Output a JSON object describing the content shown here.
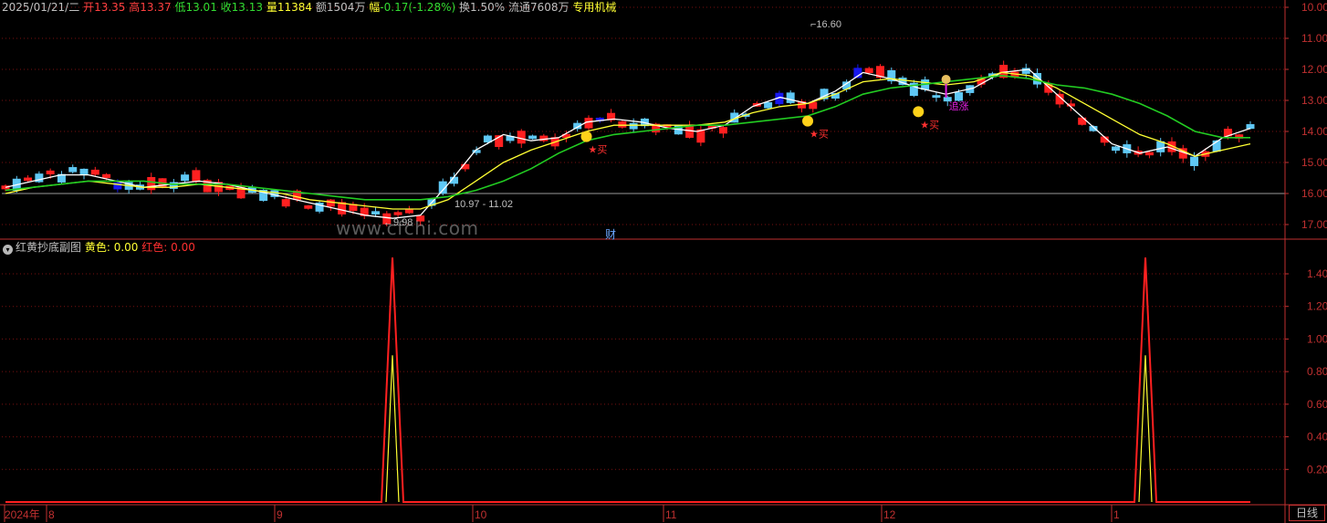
{
  "header": {
    "date": "2025/01/21/二",
    "open_label": "开",
    "open": "13.35",
    "high_label": "高",
    "high": "13.37",
    "low_label": "低",
    "low": "13.01",
    "close_label": "收",
    "close": "13.13",
    "vol_label": "量",
    "vol": "11384",
    "amount_label": "额",
    "amount": "1504万",
    "chg_label": "幅",
    "chg": "-0.17(-1.28%)",
    "turnover_label": "换",
    "turnover": "1.50%",
    "float_label": "流通",
    "float": "7608万",
    "sector": "专用机械"
  },
  "sub_panel": {
    "title": "红黄抄底副图",
    "yellow_label": "黄色:",
    "yellow_value": "0.00",
    "red_label": "红色:",
    "red_value": "0.00"
  },
  "annotations": {
    "high_price": "16.60",
    "low_price": "9.98",
    "range_text": "10.97 - 11.02",
    "buy": "★买",
    "surge": "追涨",
    "cai": "财",
    "watermark": "www.cfchi.com"
  },
  "axis": {
    "price_ticks": [
      "17.00",
      "16.00",
      "15.00",
      "14.00",
      "13.00",
      "12.00",
      "11.00",
      "10.00"
    ],
    "sub_ticks": [
      "1.40",
      "1.20",
      "1.00",
      "0.80",
      "0.60",
      "0.40",
      "0.20"
    ],
    "x_labels": [
      "2024年",
      "8",
      "9",
      "10",
      "11",
      "12",
      "1"
    ],
    "mode": "日线"
  },
  "colors": {
    "up": "#ff2020",
    "down_light": "#5fc8f5",
    "down_blue": "#1818f0",
    "ma_white": "#ffffff",
    "ma_yellow": "#ffff33",
    "ma_green": "#22cc22",
    "axis_red": "#c03030",
    "tick_text": "#c03030"
  },
  "chart_data": [
    {
      "type": "candlestick",
      "title": "",
      "ylim": [
        9.6,
        17.2
      ],
      "x_months": [
        "8",
        "9",
        "10",
        "11",
        "12",
        "1"
      ],
      "price_ticks": [
        10,
        11,
        12,
        13,
        14,
        15,
        16,
        17
      ],
      "marked_high": 16.6,
      "marked_low": 9.98,
      "close_ref_line": 11.0,
      "series": [
        {
          "name": "",
          "role": "ma_short_white",
          "values": [
            11.2,
            11.4,
            11.6,
            11.6,
            11.4,
            11.2,
            11.3,
            11.4,
            11.3,
            11.1,
            10.9,
            10.7,
            10.5,
            10.3,
            10.2,
            10.3,
            11.3,
            12.4,
            12.9,
            12.7,
            12.8,
            13.3,
            13.4,
            13.3,
            13.1,
            13.0,
            13.2,
            13.8,
            14.1,
            13.9,
            14.3,
            14.9,
            14.7,
            14.4,
            14.2,
            14.4,
            14.9,
            15.0,
            14.2,
            13.4,
            12.6,
            12.3,
            12.5,
            12.2,
            12.8,
            13.1
          ]
        },
        {
          "name": "",
          "role": "ma_mid_yellow",
          "values": [
            11.0,
            11.2,
            11.3,
            11.4,
            11.3,
            11.2,
            11.2,
            11.3,
            11.2,
            11.1,
            11.0,
            10.8,
            10.7,
            10.6,
            10.5,
            10.5,
            10.8,
            11.4,
            12.0,
            12.4,
            12.7,
            13.0,
            13.2,
            13.2,
            13.2,
            13.2,
            13.3,
            13.6,
            13.8,
            13.9,
            14.2,
            14.6,
            14.7,
            14.6,
            14.5,
            14.6,
            14.9,
            14.8,
            14.4,
            13.9,
            13.4,
            12.9,
            12.6,
            12.2,
            12.4,
            12.6
          ]
        },
        {
          "name": "",
          "role": "ma_long_green",
          "values": [
            11.1,
            11.2,
            11.3,
            11.4,
            11.4,
            11.4,
            11.3,
            11.3,
            11.3,
            11.2,
            11.1,
            11.0,
            10.9,
            10.8,
            10.8,
            10.8,
            10.9,
            11.1,
            11.4,
            11.8,
            12.3,
            12.7,
            12.9,
            13.0,
            13.1,
            13.2,
            13.2,
            13.3,
            13.4,
            13.5,
            13.8,
            14.2,
            14.4,
            14.5,
            14.6,
            14.7,
            14.8,
            14.7,
            14.5,
            14.4,
            14.2,
            13.9,
            13.5,
            13.0,
            12.8,
            12.8
          ]
        }
      ],
      "signals": [
        {
          "label": "★买",
          "x_index": 21,
          "price": 12.6
        },
        {
          "label": "★买",
          "x_index": 29,
          "price": 13.1
        },
        {
          "label": "★买",
          "x_index": 33,
          "price": 13.4
        },
        {
          "label": "追涨",
          "x_index": 34,
          "price": 14.5
        },
        {
          "label": "追涨",
          "x_index": 54,
          "price": 12.3
        }
      ]
    },
    {
      "type": "line",
      "title": "红黄抄底副图",
      "ylim": [
        0,
        1.6
      ],
      "series": [
        {
          "name": "红色",
          "spikes": [
            {
              "at": "early-Oct",
              "value": 1.5
            },
            {
              "at": "early-Jan",
              "value": 1.5
            }
          ]
        },
        {
          "name": "黄色",
          "spikes": [
            {
              "at": "early-Oct",
              "value": 0.9
            },
            {
              "at": "early-Jan",
              "value": 0.9
            }
          ]
        }
      ]
    }
  ]
}
